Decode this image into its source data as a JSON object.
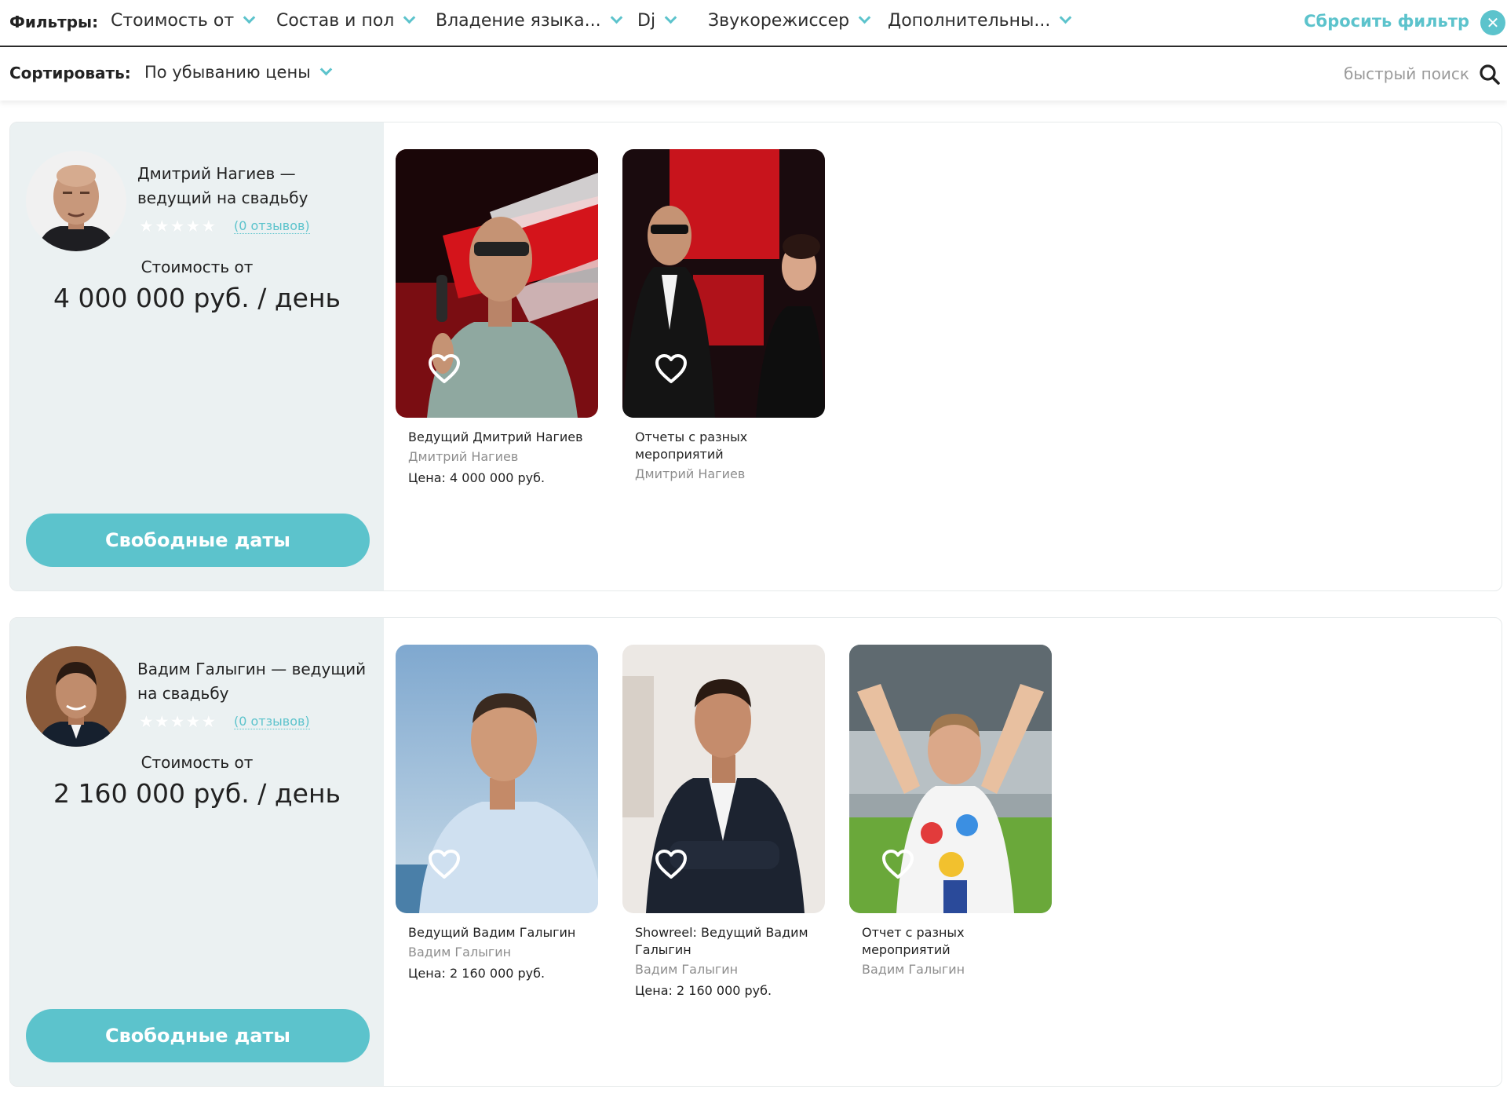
{
  "filters": {
    "label": "Фильтры:",
    "items": [
      "Стоимость от",
      "Состав и пол",
      "Владение языка...",
      "Dj",
      "Звукорежиссер",
      "Дополнительны..."
    ],
    "reset_label": "Сбросить фильтр",
    "reset_icon": "close-icon"
  },
  "sort": {
    "label": "Сортировать:",
    "selected": "По убыванию цены",
    "search_placeholder": "быстрый поиск"
  },
  "colors": {
    "accent": "#5cc3cc",
    "panel": "#ebf1f2"
  },
  "cards": [
    {
      "name": "Дмитрий Нагиев — ведущий на свадьбу",
      "reviews": "(0 отзывов)",
      "price_label": "Стоимость от",
      "price_value": "4 000 000 руб. / день",
      "button_label": "Свободные даты",
      "media": [
        {
          "title": "Ведущий Дмитрий Нагиев",
          "author": "Дмитрий Нагиев",
          "price": "Цена: 4 000 000 руб."
        },
        {
          "title": "Отчеты с разных мероприятий",
          "author": "Дмитрий Нагиев"
        }
      ]
    },
    {
      "name": "Вадим Галыгин — ведущий на свадьбу",
      "reviews": "(0 отзывов)",
      "price_label": "Стоимость от",
      "price_value": "2 160 000 руб. / день",
      "button_label": "Свободные даты",
      "media": [
        {
          "title": "Ведущий Вадим Галыгин",
          "author": "Вадим Галыгин",
          "price": "Цена: 2 160 000 руб."
        },
        {
          "title": "Showreel: Ведущий Вадим Галыгин",
          "author": "Вадим Галыгин",
          "price": "Цена: 2 160 000 руб."
        },
        {
          "title": "Отчет с разных мероприятий",
          "author": "Вадим Галыгин"
        }
      ]
    }
  ]
}
